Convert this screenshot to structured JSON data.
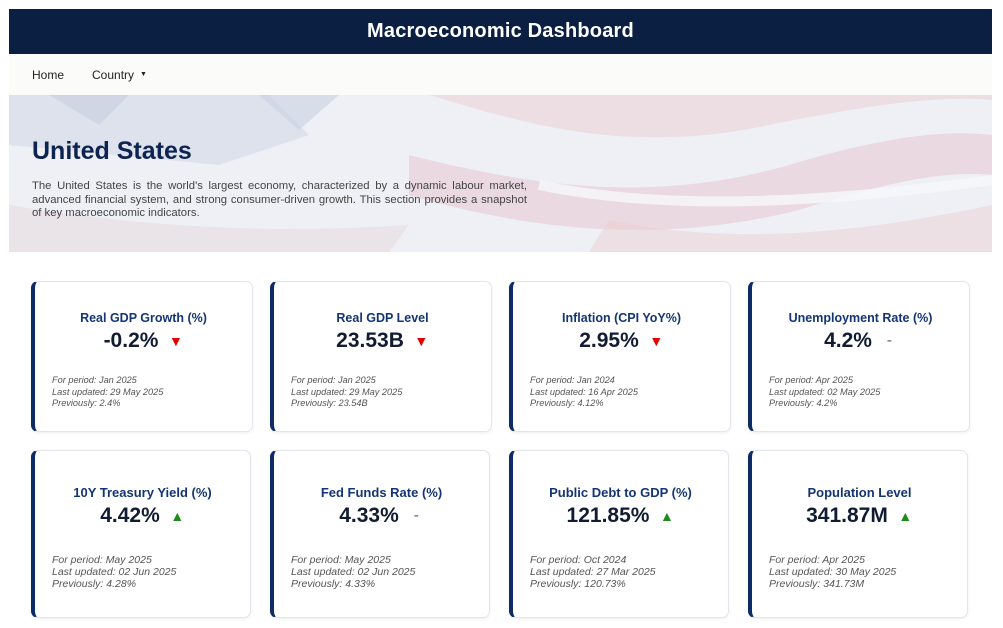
{
  "header": {
    "title": "Macroeconomic Dashboard"
  },
  "nav": {
    "home": "Home",
    "country": "Country"
  },
  "hero": {
    "country": "United States",
    "description": "The United States is the world's largest economy, characterized by a dynamic labour market, advanced financial system, and strong consumer-driven growth. This section provides a snapshot of key macroeconomic indicators."
  },
  "colors": {
    "header_bg": "#0b1f42",
    "card_accent": "#0d2c66",
    "down": "#e00000",
    "up": "#1f8a1f"
  },
  "cards": [
    {
      "title": "Real GDP Growth (%)",
      "value": "-0.2%",
      "trend": "down",
      "period": "For period: Jan 2025",
      "updated": "Last updated: 29 May 2025",
      "previous": "Previously: 2.4%"
    },
    {
      "title": "Real GDP Level",
      "value": "23.53B",
      "trend": "down",
      "period": "For period: Jan 2025",
      "updated": "Last updated: 29 May 2025",
      "previous": "Previously: 23.54B"
    },
    {
      "title": "Inflation (CPI YoY%)",
      "value": "2.95%",
      "trend": "down",
      "period": "For period: Jan 2024",
      "updated": "Last updated: 16 Apr 2025",
      "previous": "Previously: 4.12%"
    },
    {
      "title": "Unemployment Rate (%)",
      "value": "4.2%",
      "trend": "flat",
      "period": "For period: Apr 2025",
      "updated": "Last updated: 02 May 2025",
      "previous": "Previously: 4.2%"
    },
    {
      "title": "10Y Treasury Yield (%)",
      "value": "4.42%",
      "trend": "up",
      "period": "For period: May 2025",
      "updated": "Last updated: 02 Jun 2025",
      "previous": "Previously: 4.28%"
    },
    {
      "title": "Fed Funds Rate (%)",
      "value": "4.33%",
      "trend": "flat",
      "period": "For period: May 2025",
      "updated": "Last updated: 02 Jun 2025",
      "previous": "Previously: 4.33%"
    },
    {
      "title": "Public Debt to GDP (%)",
      "value": "121.85%",
      "trend": "up",
      "period": "For period: Oct 2024",
      "updated": "Last updated: 27 Mar 2025",
      "previous": "Previously: 120.73%"
    },
    {
      "title": "Population Level",
      "value": "341.87M",
      "trend": "up",
      "period": "For period: Apr 2025",
      "updated": "Last updated: 30 May 2025",
      "previous": "Previously: 341.73M"
    }
  ]
}
